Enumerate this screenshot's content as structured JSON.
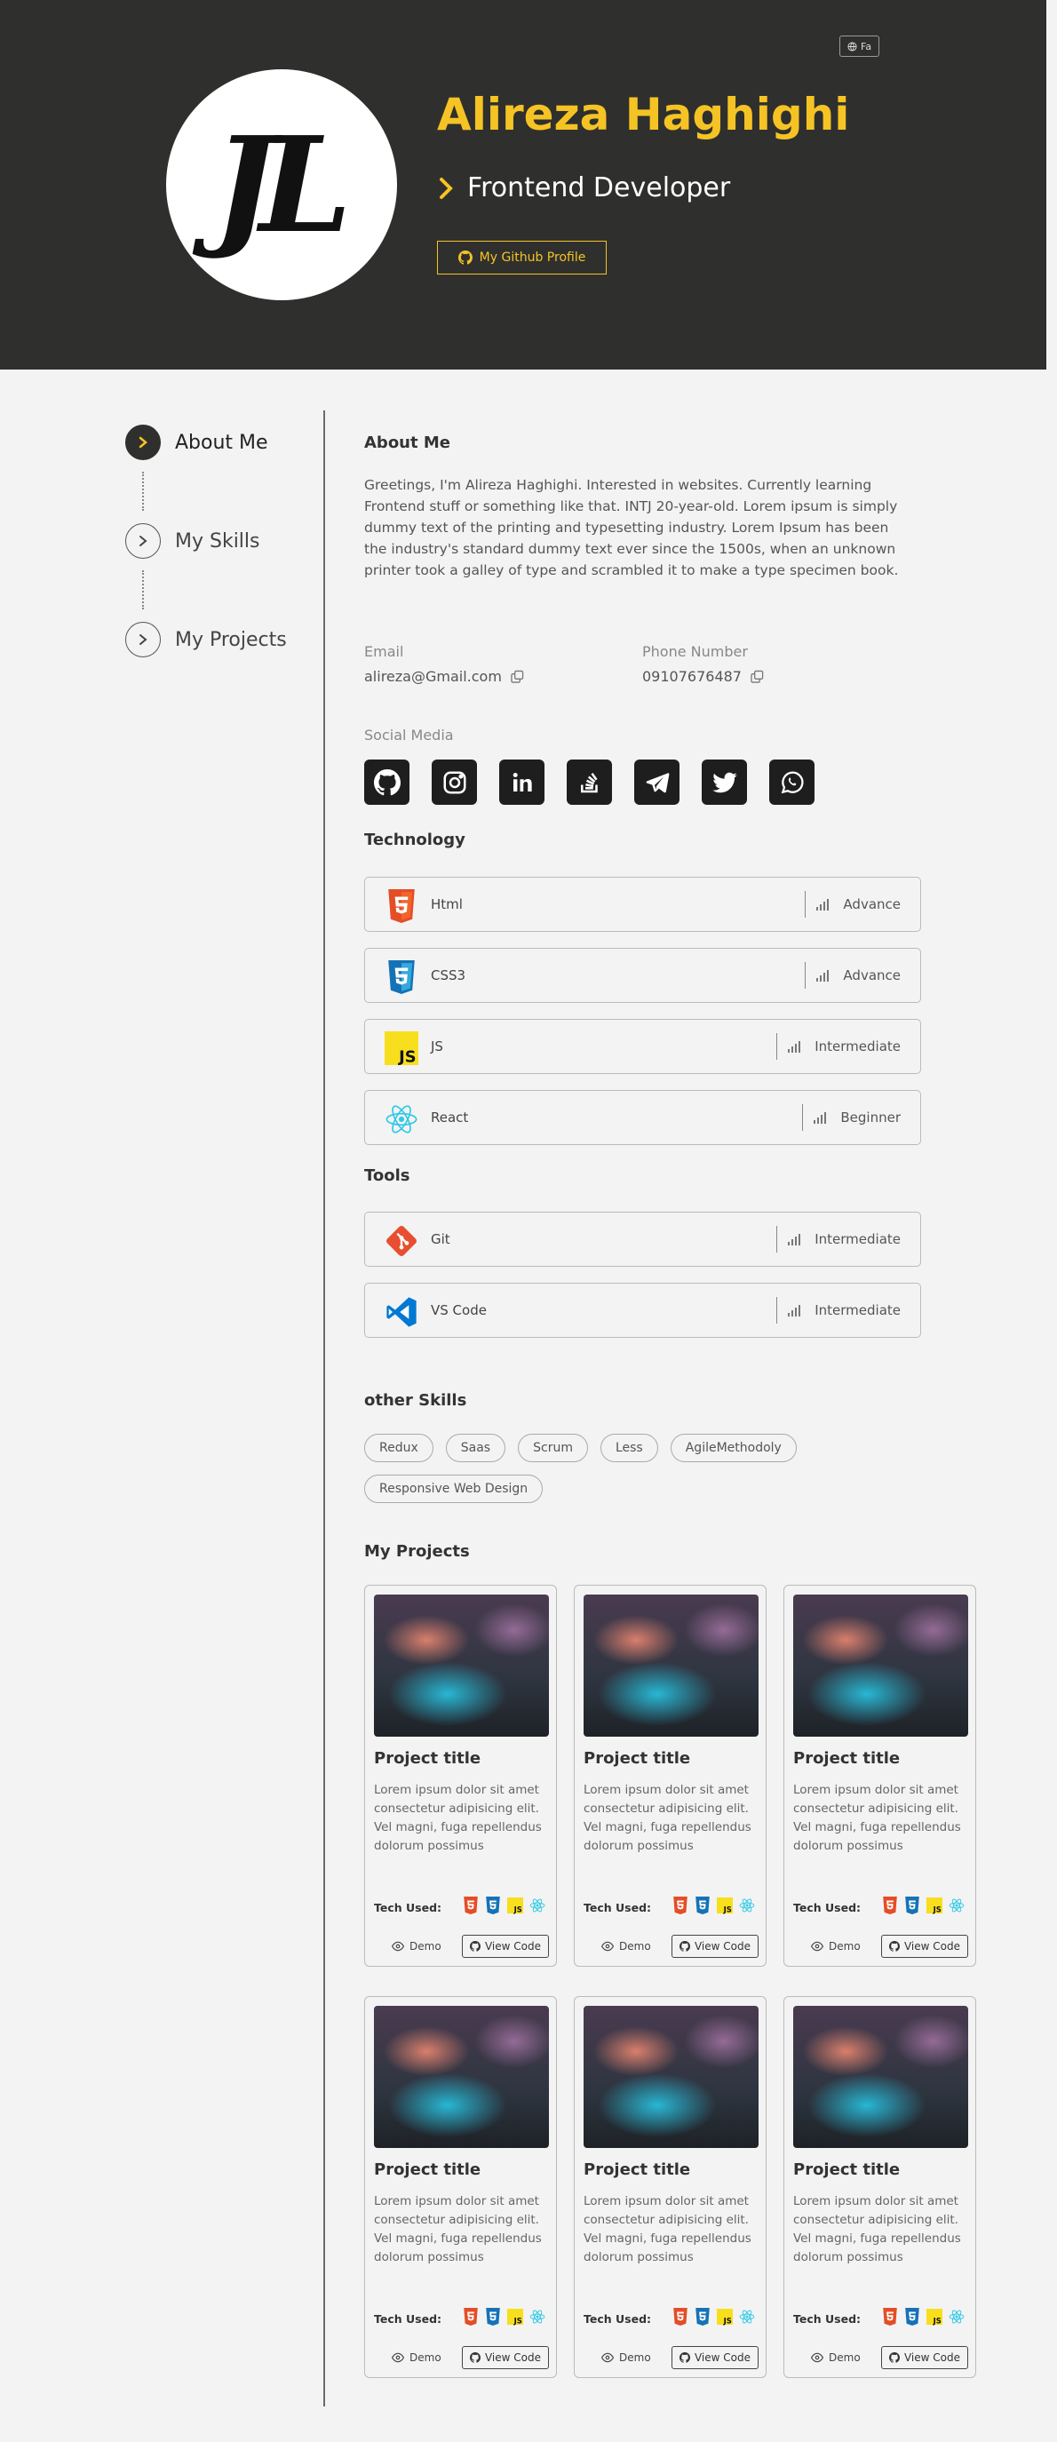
{
  "header": {
    "lang_button": "Fa",
    "name": "Alireza Haghighi",
    "role": "Frontend Developer",
    "github_button": "My Github Profile"
  },
  "sidebar": {
    "items": [
      {
        "label": "About Me",
        "active": true
      },
      {
        "label": "My Skills",
        "active": false
      },
      {
        "label": "My Projects",
        "active": false
      }
    ]
  },
  "about": {
    "heading": "About Me",
    "text": "Greetings, I'm Alireza Haghighi. Interested in websites. Currently learning Frontend stuff or something like that. INTJ 20-year-old. Lorem ipsum is simply dummy text of the printing and typesetting industry. Lorem Ipsum has been the industry's standard dummy text ever since the 1500s, when an unknown printer took a galley of type and scrambled it to make a type specimen book.",
    "email_label": "Email",
    "email_value": "alireza@Gmail.com",
    "phone_label": "Phone Number",
    "phone_value": "09107676487",
    "social_label": "Social Media",
    "social_icons": [
      "github-icon",
      "instagram-icon",
      "linkedin-icon",
      "stackoverflow-icon",
      "telegram-icon",
      "twitter-icon",
      "whatsapp-icon"
    ]
  },
  "technology": {
    "heading": "Technology",
    "items": [
      {
        "name": "Html",
        "level": "Advance",
        "icon": "html5-icon"
      },
      {
        "name": "CSS3",
        "level": "Advance",
        "icon": "css3-icon"
      },
      {
        "name": "JS",
        "level": "Intermediate",
        "icon": "js-icon"
      },
      {
        "name": "React",
        "level": "Beginner",
        "icon": "react-icon"
      }
    ]
  },
  "tools": {
    "heading": "Tools",
    "items": [
      {
        "name": "Git",
        "level": "Intermediate",
        "icon": "git-icon"
      },
      {
        "name": "VS Code",
        "level": "Intermediate",
        "icon": "vscode-icon"
      }
    ]
  },
  "other_skills": {
    "heading": "other Skills",
    "chips": [
      "Redux",
      "Saas",
      "Scrum",
      "Less",
      "AgileMethodoly",
      "Responsive Web Design"
    ]
  },
  "projects": {
    "heading": "My Projects",
    "items": [
      {
        "title": "Project title",
        "desc": "Lorem ipsum dolor sit amet consectetur adipisicing elit. Vel magni, fuga repellendus dolorum possimus",
        "tech_label": "Tech Used:",
        "demo": "Demo",
        "code": "View Code"
      },
      {
        "title": "Project title",
        "desc": "Lorem ipsum dolor sit amet consectetur adipisicing elit. Vel magni, fuga repellendus dolorum possimus",
        "tech_label": "Tech Used:",
        "demo": "Demo",
        "code": "View Code"
      },
      {
        "title": "Project title",
        "desc": "Lorem ipsum dolor sit amet consectetur adipisicing elit. Vel magni, fuga repellendus dolorum possimus",
        "tech_label": "Tech Used:",
        "demo": "Demo",
        "code": "View Code"
      },
      {
        "title": "Project title",
        "desc": "Lorem ipsum dolor sit amet consectetur adipisicing elit. Vel magni, fuga repellendus dolorum possimus",
        "tech_label": "Tech Used:",
        "demo": "Demo",
        "code": "View Code"
      },
      {
        "title": "Project title",
        "desc": "Lorem ipsum dolor sit amet consectetur adipisicing elit. Vel magni, fuga repellendus dolorum possimus",
        "tech_label": "Tech Used:",
        "demo": "Demo",
        "code": "View Code"
      },
      {
        "title": "Project title",
        "desc": "Lorem ipsum dolor sit amet consectetur adipisicing elit. Vel magni, fuga repellendus dolorum possimus",
        "tech_label": "Tech Used:",
        "demo": "Demo",
        "code": "View Code"
      }
    ]
  },
  "colors": {
    "header_bg": "#2f302e",
    "accent": "#f6c324",
    "page_bg": "#f3f3f3"
  }
}
